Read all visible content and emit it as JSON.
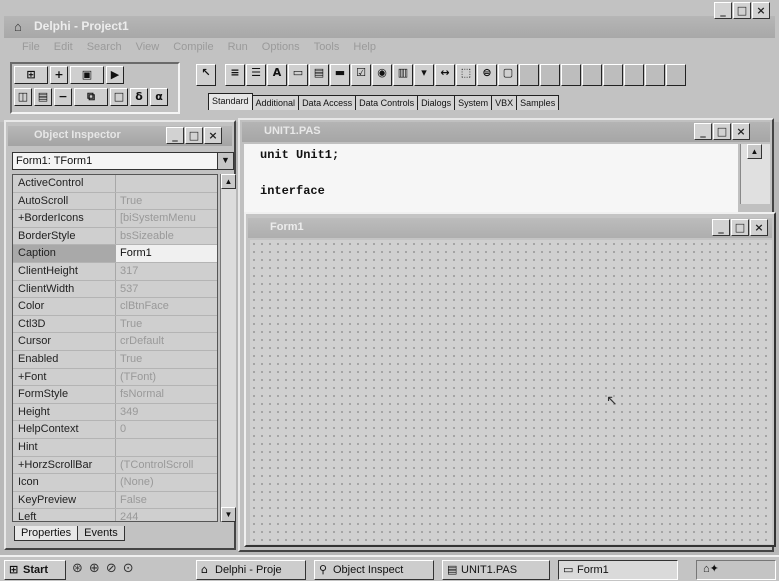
{
  "main": {
    "title": "Delphi - Project1",
    "menu": [
      "File",
      "Edit",
      "Search",
      "View",
      "Compile",
      "Run",
      "Options",
      "Tools",
      "Help"
    ],
    "speedbar": [
      {
        "icon": "open-project-icon",
        "glyph": "⊞"
      },
      {
        "icon": "add-file-icon",
        "glyph": "+"
      },
      {
        "icon": "open-file-icon",
        "glyph": "▣"
      },
      {
        "icon": "run-icon",
        "glyph": "▶"
      },
      {
        "icon": "save-project-icon",
        "glyph": "◫"
      },
      {
        "icon": "save-file-icon",
        "glyph": "▤"
      },
      {
        "icon": "remove-file-icon",
        "glyph": "−"
      },
      {
        "icon": "toggle-form-unit-icon",
        "glyph": "⧉"
      },
      {
        "icon": "new-form-icon",
        "glyph": "□"
      },
      {
        "icon": "step-over-icon",
        "glyph": "δ"
      },
      {
        "icon": "trace-into-icon",
        "glyph": "α"
      }
    ],
    "palette_tabs": [
      "Standard",
      "Additional",
      "Data Access",
      "Data Controls",
      "Dialogs",
      "System",
      "VBX",
      "Samples"
    ],
    "palette_active": "Standard",
    "palette_icons": [
      {
        "icon": "pointer-icon",
        "glyph": "↖"
      },
      {
        "icon": "mainmenu-icon",
        "glyph": "≡"
      },
      {
        "icon": "popupmenu-icon",
        "glyph": "☰"
      },
      {
        "icon": "label-icon",
        "glyph": "A"
      },
      {
        "icon": "edit-icon",
        "glyph": "▭"
      },
      {
        "icon": "memo-icon",
        "glyph": "▤"
      },
      {
        "icon": "button-icon",
        "glyph": "▬"
      },
      {
        "icon": "checkbox-icon",
        "glyph": "☑"
      },
      {
        "icon": "radiobutton-icon",
        "glyph": "◉"
      },
      {
        "icon": "listbox-icon",
        "glyph": "▥"
      },
      {
        "icon": "combobox-icon",
        "glyph": "▾"
      },
      {
        "icon": "scrollbar-icon",
        "glyph": "↔"
      },
      {
        "icon": "groupbox-icon",
        "glyph": "⬚"
      },
      {
        "icon": "radiogroup-icon",
        "glyph": "⊜"
      },
      {
        "icon": "panel-icon",
        "glyph": "▢"
      }
    ]
  },
  "inspector": {
    "title": "Object Inspector",
    "selected_object": "Form1: TForm1",
    "properties": [
      {
        "name": "ActiveControl",
        "value": ""
      },
      {
        "name": "AutoScroll",
        "value": "True"
      },
      {
        "name": "+BorderIcons",
        "value": "[biSystemMenu"
      },
      {
        "name": "BorderStyle",
        "value": "bsSizeable"
      },
      {
        "name": "Caption",
        "value": "Form1"
      },
      {
        "name": "ClientHeight",
        "value": "317"
      },
      {
        "name": "ClientWidth",
        "value": "537"
      },
      {
        "name": "Color",
        "value": "clBtnFace"
      },
      {
        "name": "Ctl3D",
        "value": "True"
      },
      {
        "name": "Cursor",
        "value": "crDefault"
      },
      {
        "name": "Enabled",
        "value": "True"
      },
      {
        "name": "+Font",
        "value": "(TFont)"
      },
      {
        "name": "FormStyle",
        "value": "fsNormal"
      },
      {
        "name": "Height",
        "value": "349"
      },
      {
        "name": "HelpContext",
        "value": "0"
      },
      {
        "name": "Hint",
        "value": ""
      },
      {
        "name": "+HorzScrollBar",
        "value": "(TControlScroll"
      },
      {
        "name": "Icon",
        "value": "(None)"
      },
      {
        "name": "KeyPreview",
        "value": "False"
      },
      {
        "name": "Left",
        "value": "244"
      }
    ],
    "selected_index": 4,
    "tabs": [
      "Properties",
      "Events"
    ]
  },
  "editor": {
    "title": "UNIT1.PAS",
    "lines": [
      "unit Unit1;",
      "",
      "interface"
    ]
  },
  "form1": {
    "title": "Form1"
  },
  "taskbar": {
    "start": "Start",
    "quicklaunch": [
      "⊛",
      "⊕",
      "⊘",
      "⊙"
    ],
    "buttons": [
      {
        "label": "Delphi - Proje",
        "glyph": "⌂"
      },
      {
        "label": "Object Inspect",
        "glyph": "⚲"
      },
      {
        "label": "UNIT1.PAS",
        "glyph": "▤"
      },
      {
        "label": "Form1",
        "glyph": "▭",
        "pressed": true
      }
    ],
    "tray_text": "⌂✦"
  }
}
